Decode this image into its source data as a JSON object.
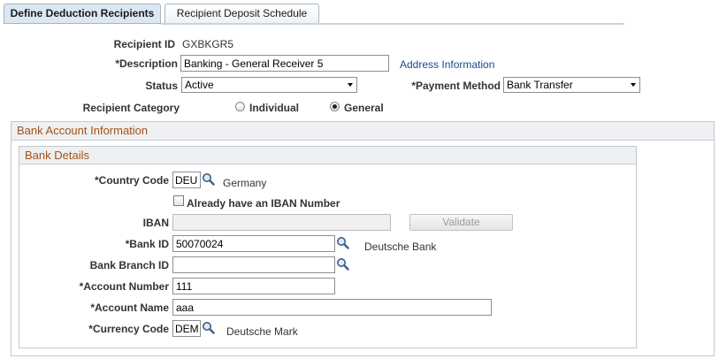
{
  "tabs": [
    {
      "label": "Define Deduction Recipients",
      "active": true
    },
    {
      "label": "Recipient Deposit Schedule",
      "active": false
    }
  ],
  "header": {
    "recipient_id_label": "Recipient ID",
    "recipient_id_value": "GXBKGR5",
    "description_label": "*Description",
    "description_value": "Banking - General Receiver 5",
    "address_link": "Address Information",
    "status_label": "Status",
    "status_value": "Active",
    "payment_method_label": "*Payment Method",
    "payment_method_value": "Bank Transfer",
    "recipient_category_label": "Recipient Category",
    "category_options": [
      {
        "label": "Individual",
        "selected": false
      },
      {
        "label": "General",
        "selected": true
      }
    ]
  },
  "bank_account": {
    "title": "Bank Account Information",
    "details_title": "Bank Details",
    "country_code_label": "*Country Code",
    "country_code_value": "DEU",
    "country_name": "Germany",
    "iban_checkbox_label": "Already have an IBAN Number",
    "iban_checked": false,
    "iban_label": "IBAN",
    "iban_value": "",
    "validate_label": "Validate",
    "bank_id_label": "*Bank ID",
    "bank_id_value": "50070024",
    "bank_name": "Deutsche Bank",
    "branch_id_label": "Bank Branch ID",
    "branch_id_value": "",
    "account_number_label": "*Account Number",
    "account_number_value": "111",
    "account_name_label": "*Account Name",
    "account_name_value": "aaa",
    "currency_code_label": "*Currency Code",
    "currency_code_value": "DEM",
    "currency_name": "Deutsche Mark"
  },
  "icons": {
    "lookup": "magnifier-icon",
    "dropdown": "chevron-down-icon"
  },
  "colors": {
    "section_title": "#a3521b",
    "link": "#1b4a8c",
    "active_tab": "#dbe7f3"
  }
}
